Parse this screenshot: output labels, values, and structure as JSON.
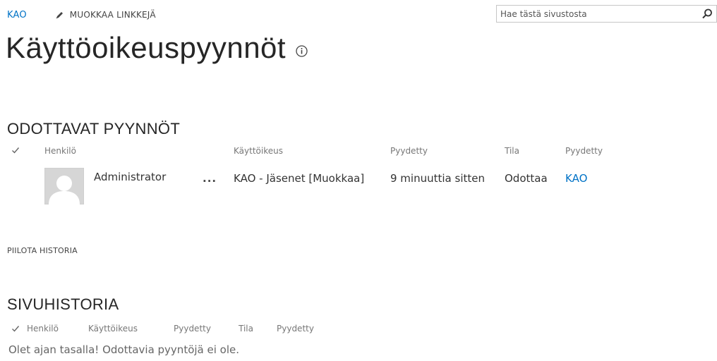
{
  "top_nav": {
    "site_link": "KAO",
    "edit_links_label": "MUOKKAA LINKKEJÄ"
  },
  "search": {
    "placeholder": "Hae tästä sivustosta",
    "icon": "search-icon"
  },
  "page": {
    "title": "Käyttöoikeuspyynnöt",
    "info_icon": "info-icon"
  },
  "pending": {
    "title": "ODOTTAVAT PYYNNÖT",
    "columns": [
      "Henkilö",
      "Käyttöikeus",
      "Pyydetty",
      "Tila",
      "Pyydetty"
    ],
    "rows": [
      {
        "person": "Administrator",
        "menu": "...",
        "permission": "KAO - Jäsenet [Muokkaa]",
        "requested": "9 minuuttia sitten",
        "status": "Odottaa",
        "requested_from": "KAO"
      }
    ]
  },
  "history_toggle": {
    "label": "PIILOTA HISTORIA"
  },
  "history": {
    "title": "SIVUHISTORIA",
    "columns": [
      "Henkilö",
      "Käyttöikeus",
      "Pyydetty",
      "Tila",
      "Pyydetty"
    ],
    "empty_message": "Olet ajan tasalla! Odottavia pyyntöjä ei ole."
  },
  "colors": {
    "link": "#0072c6",
    "title": "#262626",
    "muted": "#777777"
  }
}
